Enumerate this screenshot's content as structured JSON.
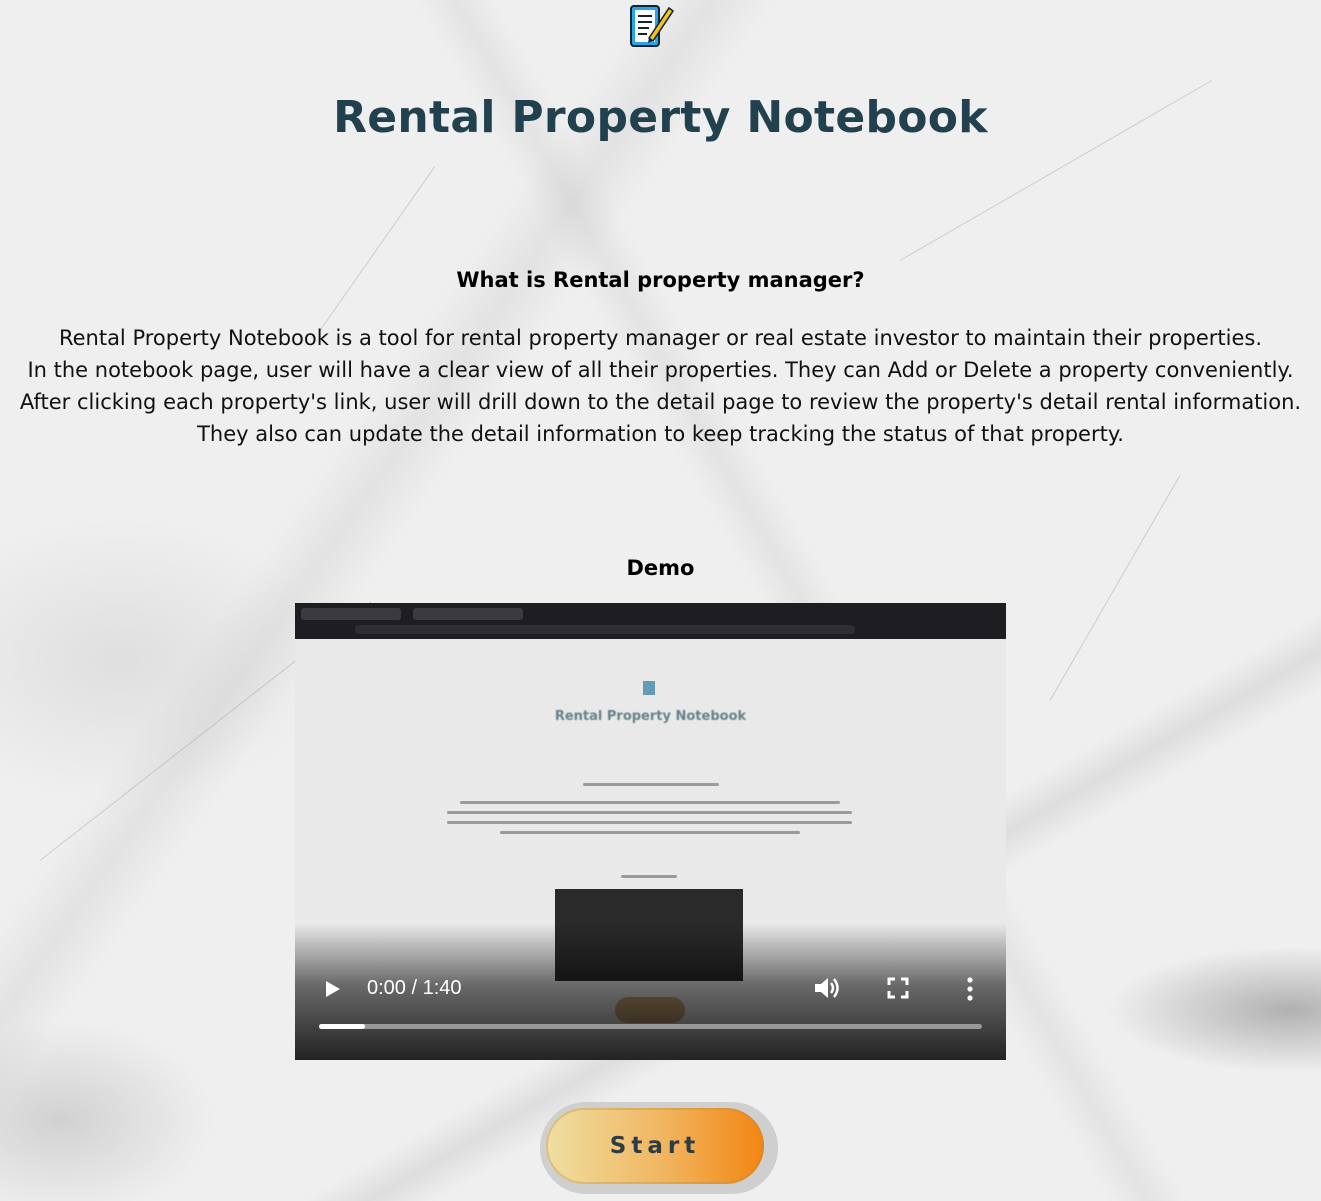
{
  "header": {
    "logo_icon": "notebook-pencil-icon",
    "title": "Rental Property Notebook"
  },
  "about": {
    "heading": "What is Rental property manager?",
    "lines": [
      "Rental Property Notebook is a tool for rental property manager or real estate investor to maintain their properties.",
      "In the notebook page, user will have a clear view of all their properties. They can Add or Delete a property conveniently.",
      "After clicking each property's link, user will drill down to the detail page to review the property's detail rental information.",
      "They also can update the detail information to keep tracking the status of that property."
    ]
  },
  "demo": {
    "heading": "Demo",
    "video": {
      "time_display": "0:00 / 1:40",
      "progress_fraction": 0.07,
      "preview_title": "Rental Property Notebook",
      "icons": [
        "play-icon",
        "volume-icon",
        "fullscreen-icon",
        "more-options-icon"
      ]
    }
  },
  "cta": {
    "start_label": "Start"
  },
  "colors": {
    "title": "#21414f",
    "button_start": "#eedfa2",
    "button_end": "#f38512"
  }
}
